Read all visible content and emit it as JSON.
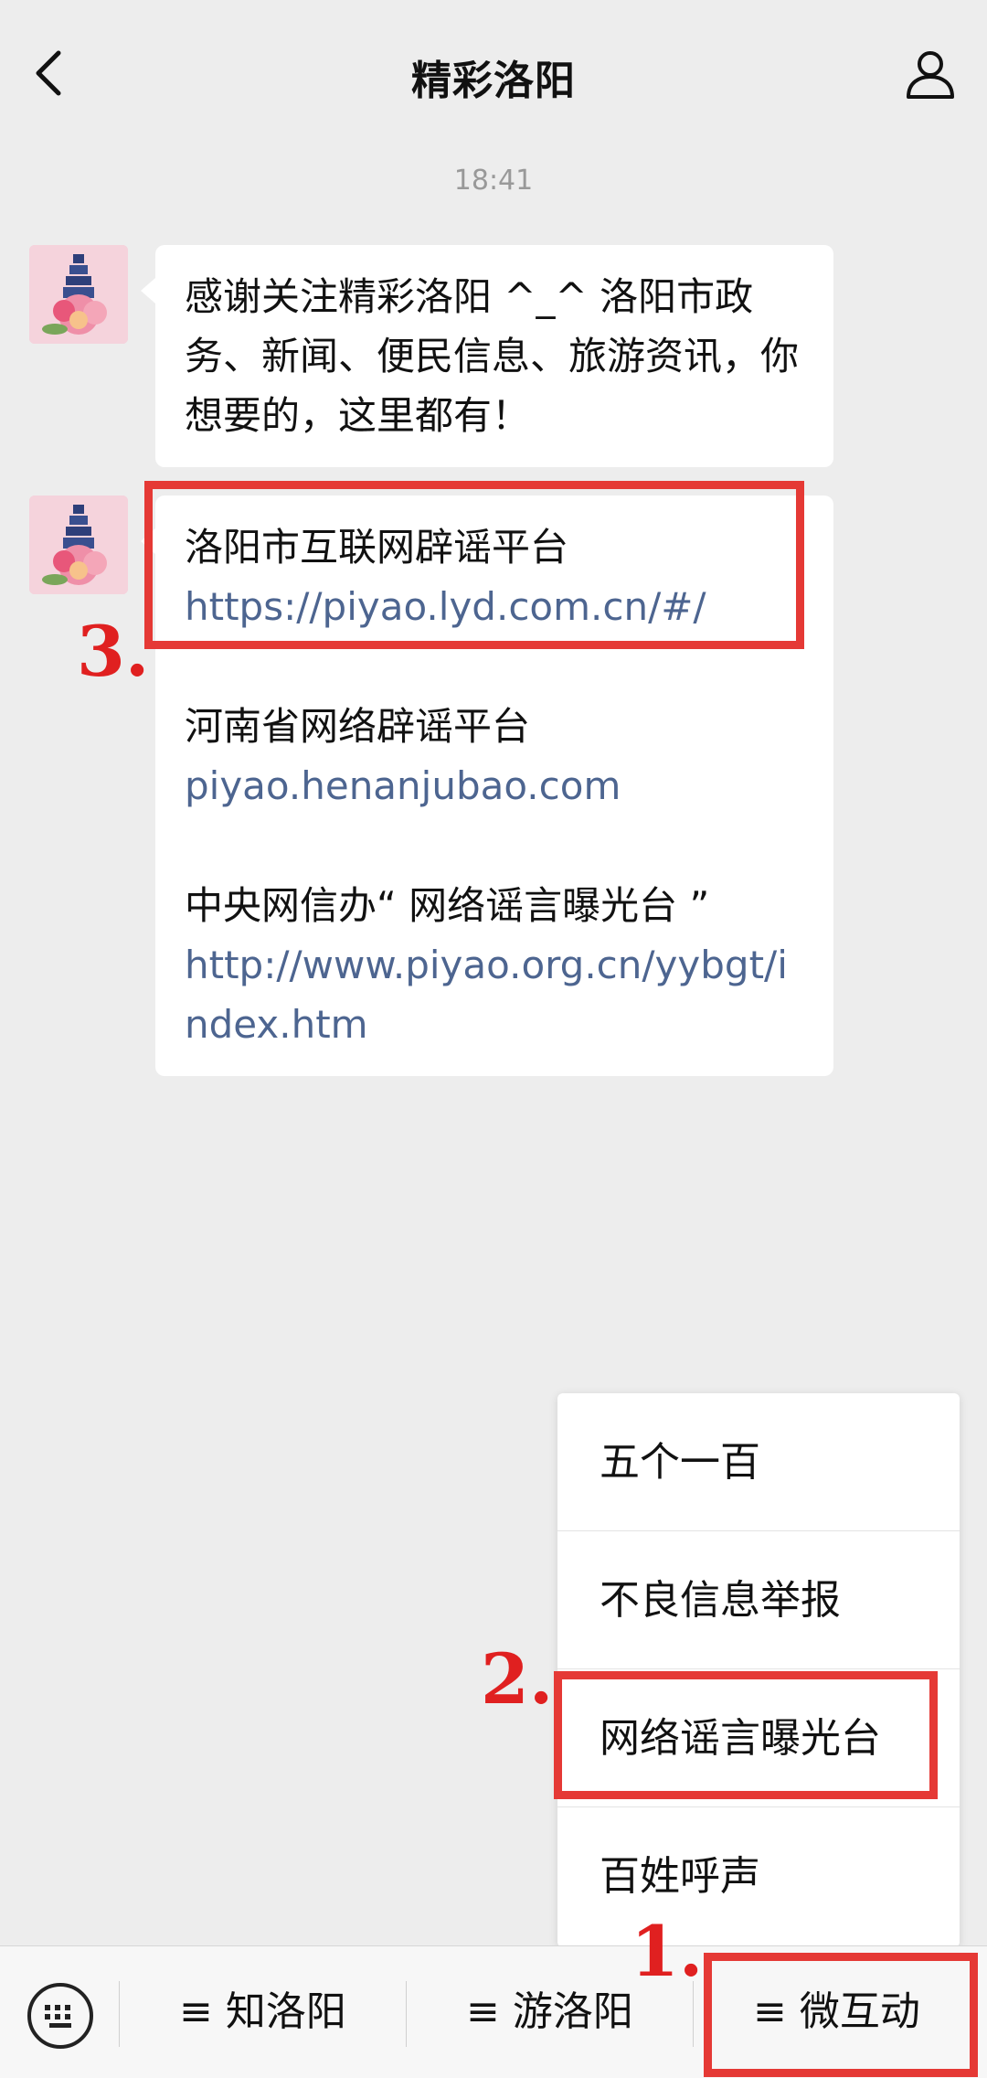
{
  "header": {
    "title": "精彩洛阳"
  },
  "chat": {
    "timestamp": "18:41",
    "welcome_message": "感谢关注精彩洛阳 ^_^  洛阳市政务、新闻、便民信息、旅游资讯，你想要的，这里都有！",
    "links_message": [
      {
        "name": "洛阳市互联网辟谣平台",
        "url": "https://piyao.lyd.com.cn/#/"
      },
      {
        "name": "河南省网络辟谣平台",
        "url": "piyao.henanjubao.com"
      },
      {
        "name": "中央网信办“ 网络谣言曝光台 ”",
        "url": "http://www.piyao.org.cn/yybgt/index.htm"
      }
    ]
  },
  "annotations": {
    "step1": "1.",
    "step2": "2.",
    "step3": "3.",
    "color": "#e53935"
  },
  "popup_menu": {
    "items": [
      "五个一百",
      "不良信息举报",
      "网络谣言曝光台",
      "百姓呼声"
    ]
  },
  "bottom_menu": {
    "tabs": [
      "≡ 知洛阳",
      "≡ 游洛阳",
      "≡ 微互动"
    ]
  },
  "icons": [
    "back-arrow-icon",
    "profile-icon",
    "keyboard-icon",
    "avatar-pagoda-peony"
  ]
}
